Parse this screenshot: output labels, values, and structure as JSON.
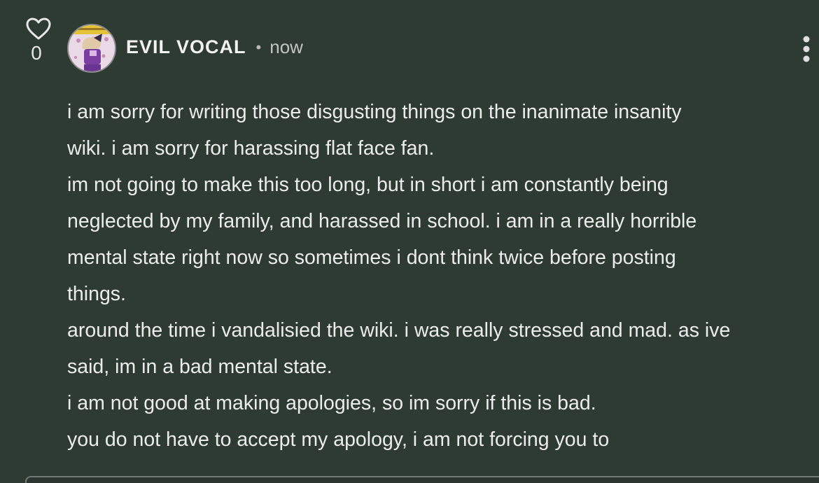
{
  "comment": {
    "likes": {
      "count": "0",
      "icon": "heart-icon"
    },
    "author": {
      "name": "EVIL VOCAL",
      "avatar": "user-avatar"
    },
    "separator": "•",
    "timestamp": "now",
    "menu_icon": "vertical-dots-icon",
    "body_lines": [
      "i am sorry for writing those disgusting things on the inanimate insanity",
      "wiki. i am sorry for harassing flat face fan.",
      "im not going to make this too long, but in short i am constantly being",
      "neglected by my family, and harassed in school. i am in a really horrible",
      "mental state right now so sometimes i dont think twice before posting",
      "things.",
      "around the time i vandalisied the wiki. i was really stressed and mad. as ive",
      "said, im in a bad mental state.",
      "i am not good at making apologies, so im sorry if this is bad.",
      "you do not have to accept my apology, i am not forcing you to"
    ]
  },
  "colors": {
    "background": "#2e3b32",
    "text": "#ececec",
    "muted": "#c4c4c4"
  }
}
